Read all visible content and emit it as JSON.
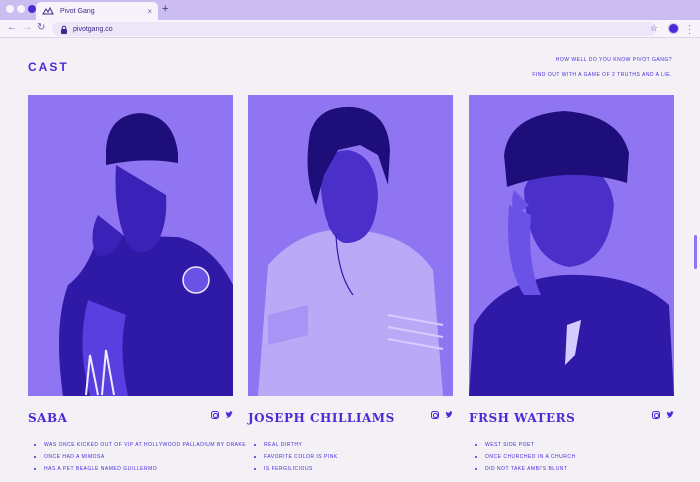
{
  "browser": {
    "tab_title": "Pivot Gang",
    "url": "pivotgang.co",
    "new_tab": "+",
    "close": "×"
  },
  "colors": {
    "accent": "#4a2bd6",
    "photo": "#8f75f2",
    "background": "#f3f1f6"
  },
  "header": {
    "title": "CAST",
    "question": "How well do you know Pivot Gang?",
    "cta": "Find out with a game of 2 truths and a lie."
  },
  "cast": [
    {
      "name": "SABA",
      "icons": [
        "instagram-icon",
        "twitter-icon"
      ],
      "facts": [
        "Was once kicked out of VIP at Hollywood Palladium by Drake",
        "Once had a mimosa",
        "Has a pet beagle named Guillermo"
      ]
    },
    {
      "name": "JOSEPH CHILLIAMS",
      "icons": [
        "instagram-icon",
        "twitter-icon"
      ],
      "facts": [
        "Real dirthy",
        "Favorite color is pink",
        "Is fergilicious"
      ]
    },
    {
      "name": "FRSH WATERS",
      "icons": [
        "instagram-icon",
        "twitter-icon"
      ],
      "facts": [
        "West side poet",
        "Once churched in a church",
        "Did not take Ambi's blunt"
      ]
    }
  ]
}
